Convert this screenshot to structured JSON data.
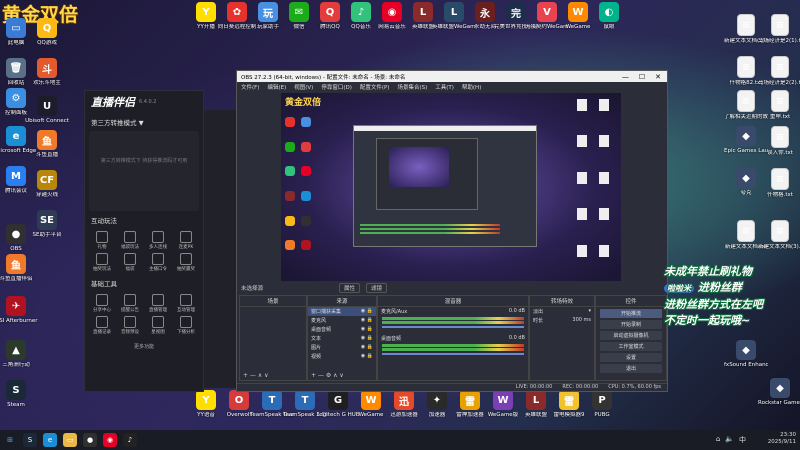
{
  "banner": "黄金双倍",
  "desktop_left": [
    {
      "label": "此电脑",
      "icon": "computer-icon",
      "color": "#3a7bd5",
      "glyph": "▭"
    },
    {
      "label": "回收站",
      "icon": "recycle-bin-icon",
      "color": "#5a6f88",
      "glyph": "🗑"
    },
    {
      "label": "控制面板",
      "icon": "control-panel-icon",
      "color": "#3c8ee0",
      "glyph": "⚙"
    },
    {
      "label": "Microsoft Edge",
      "icon": "edge-icon",
      "color": "#1b8fd6",
      "glyph": "e"
    },
    {
      "label": "腾讯会议",
      "icon": "tencent-meeting-icon",
      "color": "#2a7ff0",
      "glyph": "M"
    },
    {
      "label": "OBS",
      "icon": "obs-icon",
      "color": "#303030",
      "glyph": "●"
    },
    {
      "label": "斗鱼直播伴侣",
      "icon": "douyu-icon",
      "color": "#f07a2a",
      "glyph": "鱼"
    },
    {
      "label": "MSI Afterburner",
      "icon": "afterburner-icon",
      "color": "#b0121f",
      "glyph": "✈"
    },
    {
      "label": "三角洲行动",
      "icon": "delta-force-icon",
      "color": "#2c3a2c",
      "glyph": "▲"
    },
    {
      "label": "Steam",
      "icon": "steam-icon",
      "color": "#1b2838",
      "glyph": "S"
    }
  ],
  "desktop_left2": [
    {
      "label": "QQ游戏",
      "icon": "qq-game-icon",
      "color": "#fcb813",
      "glyph": "Q"
    },
    {
      "label": "欢乐斗地主",
      "icon": "landlord-icon",
      "color": "#e35a2f",
      "glyph": "斗"
    },
    {
      "label": "Ubisoft Connect",
      "icon": "ubisoft-icon",
      "color": "#1c1c2a",
      "glyph": "U"
    },
    {
      "label": "斗鱼直播",
      "icon": "douyu-live-icon",
      "color": "#f07a2a",
      "glyph": "鱼"
    },
    {
      "label": "穿越火线",
      "icon": "crossfire-icon",
      "color": "#b8860b",
      "glyph": "CF"
    },
    {
      "label": "SE助手平台",
      "icon": "se-assistant-icon",
      "color": "#2f3b55",
      "glyph": "SE"
    }
  ],
  "desktop_top": [
    {
      "label": "YY开播",
      "icon": "yy-icon",
      "color": "#ffde00",
      "glyph": "Y"
    },
    {
      "label": "向日葵远程控制",
      "icon": "sunflower-icon",
      "color": "#e5322d",
      "glyph": "✿"
    },
    {
      "label": "玩家助手",
      "icon": "player-assistant-icon",
      "color": "#4a90e2",
      "glyph": "玩"
    },
    {
      "label": "微信",
      "icon": "wechat-icon",
      "color": "#1aad19",
      "glyph": "✉"
    },
    {
      "label": "腾讯QQ",
      "icon": "qq-icon",
      "color": "#e23c3c",
      "glyph": "Q"
    },
    {
      "label": "QQ音乐",
      "icon": "qq-music-icon",
      "color": "#31c27c",
      "glyph": "♪"
    },
    {
      "label": "网易云音乐",
      "icon": "netease-music-icon",
      "color": "#e60026",
      "glyph": "◉"
    },
    {
      "label": "英雄联盟",
      "icon": "lol-icon",
      "color": "#8a2a2a",
      "glyph": "L"
    },
    {
      "label": "英雄联盟WeGame版",
      "icon": "lol-wegame-icon",
      "color": "#2a4a6a",
      "glyph": "L"
    },
    {
      "label": "永劫无间",
      "icon": "naraka-icon",
      "color": "#6b1f1f",
      "glyph": "永"
    },
    {
      "label": "完美世界竞技平台",
      "icon": "perfect-world-icon",
      "color": "#1d2d4a",
      "glyph": "完"
    },
    {
      "label": "无畏契约WeGame版",
      "icon": "valorant-icon",
      "color": "#e8434e",
      "glyph": "V"
    },
    {
      "label": "WeGame",
      "icon": "wegame-icon",
      "color": "#ff8a00",
      "glyph": "W"
    },
    {
      "label": "鼠眼",
      "icon": "mouse-eye-icon",
      "color": "#00b38a",
      "glyph": "◐"
    }
  ],
  "desktop_right": [
    {
      "label": "新建文本文档(2).txt",
      "icon": "text-file-icon"
    },
    {
      "label": "马场经济是2(1).txt",
      "icon": "text-file-icon"
    },
    {
      "label": "仟物格82.txt",
      "icon": "text-file-icon"
    },
    {
      "label": "马场经济是2(2).txt",
      "icon": "text-file-icon"
    },
    {
      "label": "了解相关近期的故事",
      "icon": "text-file-icon"
    },
    {
      "label": "重申.txt",
      "icon": "text-file-icon"
    },
    {
      "label": "Epic Games Launcher",
      "icon": "epic-icon"
    },
    {
      "label": "误入你.txt",
      "icon": "text-file-icon"
    },
    {
      "label": "夸克",
      "icon": "quark-icon"
    },
    {
      "label": "仟物格.txt",
      "icon": "text-file-icon"
    },
    {
      "label": "新建文本文档.txt",
      "icon": "text-file-icon"
    },
    {
      "label": "新建文本文档(3).txt",
      "icon": "text-file-icon"
    },
    {
      "label": "fxSound Enhancer",
      "icon": "fxsound-icon"
    },
    {
      "label": "Rockstar Games",
      "icon": "rockstar-icon"
    }
  ],
  "desktop_bottom": [
    {
      "label": "YY语音",
      "icon": "yy-voice-icon",
      "color": "#ffde00",
      "glyph": "Y"
    },
    {
      "label": "Overwolf",
      "icon": "overwolf-icon",
      "color": "#d63b3b",
      "glyph": "O"
    },
    {
      "label": "TeamSpeak Overlay",
      "icon": "teamspeak-overlay-icon",
      "color": "#2c6bb5",
      "glyph": "T"
    },
    {
      "label": "TeamSpeak 3 Client",
      "icon": "teamspeak-icon",
      "color": "#2c6bb5",
      "glyph": "T"
    },
    {
      "label": "Logitech G HUB",
      "icon": "ghub-icon",
      "color": "#1f1f1f",
      "glyph": "G"
    },
    {
      "label": "WeGame",
      "icon": "wegame-bottom-icon",
      "color": "#ff8a00",
      "glyph": "W"
    },
    {
      "label": "迅游加速器",
      "icon": "xunyou-icon",
      "color": "#e44a2a",
      "glyph": "迅"
    },
    {
      "label": "加速器",
      "icon": "accelerator-icon",
      "color": "#2a2a2a",
      "glyph": "✦"
    },
    {
      "label": "雷神加速器",
      "icon": "leishen-icon",
      "color": "#e8a100",
      "glyph": "雷"
    },
    {
      "label": "WeGame版",
      "icon": "wegame-ver-icon",
      "color": "#7b3fb5",
      "glyph": "W"
    },
    {
      "label": "英雄联盟",
      "icon": "lol-bottom-icon",
      "color": "#8a2a2a",
      "glyph": "L"
    },
    {
      "label": "雷电模拟器9",
      "icon": "ldplayer-icon",
      "color": "#f2c12e",
      "glyph": "雷"
    },
    {
      "label": "PUBG",
      "icon": "pubg-icon",
      "color": "#333",
      "glyph": "P"
    }
  ],
  "zhibo": {
    "logo": "直播伴侣",
    "version": "6.4.0.2",
    "mode": "第三方转推模式 ▼",
    "empty_hint": "第三方转推模式下 待获得推流码才可用",
    "interact_title": "互动玩法",
    "interact_tools": [
      "礼物",
      "福袋玩法",
      "多人连线",
      "连麦PK",
      "抽奖玩法",
      "福袋",
      "主播口令",
      "抽奖赢奖"
    ],
    "basic_title": "基础工具",
    "basic_tools": [
      "分享中心",
      "提醒公告",
      "直播管理",
      "互动管理",
      "直播记录",
      "音频预设",
      "星视图",
      "下播分析"
    ],
    "more": "更多功能"
  },
  "obs": {
    "title": "OBS 27.2.3 (64-bit, windows) - 配置文件: 未命名 - 场景: 未命名",
    "menu": [
      "文件(F)",
      "编辑(E)",
      "视图(V)",
      "停靠窗口(D)",
      "配置文件(P)",
      "场景集合(S)",
      "工具(T)",
      "帮助(H)"
    ],
    "preview_banner": "黄金双倍",
    "source_bar_label": "未选择源",
    "props": "属性",
    "filters": "滤镜",
    "scenes_header": "场景",
    "sources_header": "来源",
    "sources": [
      "窗口捕获采集",
      "麦克风",
      "桌面音频",
      "文本",
      "图片",
      "视频"
    ],
    "mixer_header": "混音器",
    "mixer_rows": [
      {
        "name": "麦克风/Aux",
        "db": "0.0 dB"
      },
      {
        "name": "桌面音频",
        "db": "0.0 dB"
      }
    ],
    "transitions_header": "转场特效",
    "transition_type": "淡出",
    "duration_label": "时长",
    "duration_value": "300 ms",
    "controls_header": "控件",
    "controls": [
      "开始推流",
      "开始录制",
      "启动虚拟摄像机",
      "工作室模式",
      "设置",
      "退出"
    ],
    "status": [
      "LIVE: 00:00:00",
      "REC: 00:00:00",
      "CPU: 0.7%, 60.00 fps"
    ]
  },
  "overlay": {
    "line1": "未成年禁止刷礼物",
    "tag": "啦啦米",
    "line2": "进粉丝群",
    "line3": "进粉丝群方式在左吧",
    "line4": "不定时一起玩哦~"
  },
  "tray": {
    "time": "23:30",
    "date": "2025/9/11",
    "lang": "中"
  }
}
